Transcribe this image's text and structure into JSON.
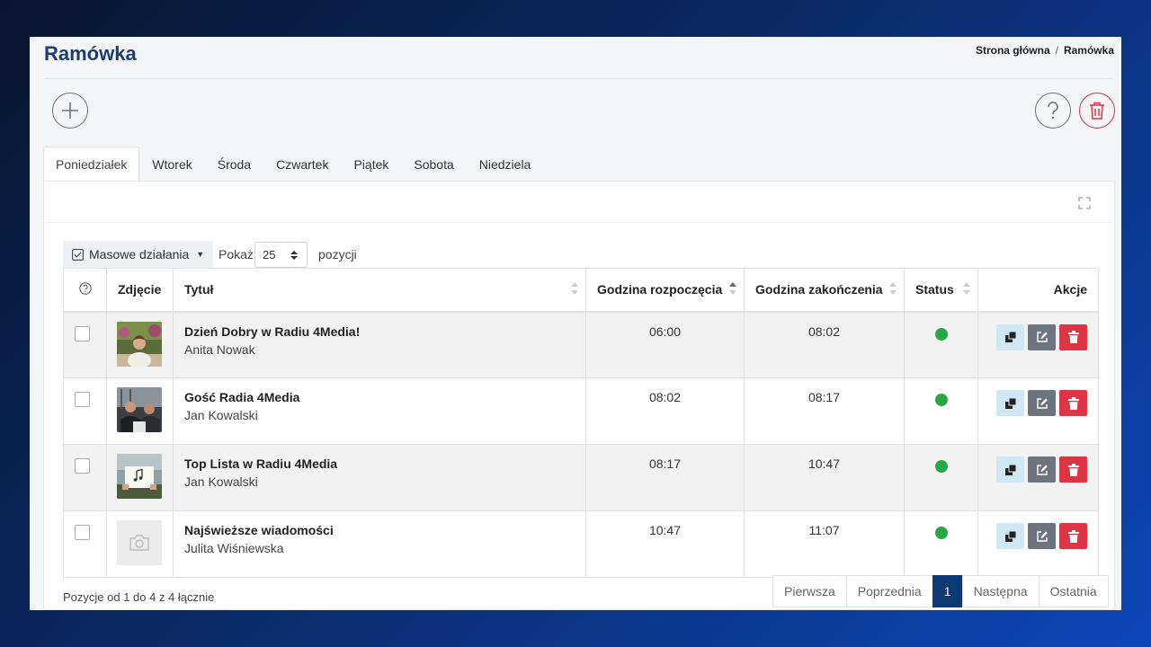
{
  "page": {
    "title": "Ramówka"
  },
  "breadcrumb": {
    "home": "Strona główna",
    "sep": "/",
    "current": "Ramówka"
  },
  "tabs": [
    "Poniedziałek",
    "Wtorek",
    "Środa",
    "Czwartek",
    "Piątek",
    "Sobota",
    "Niedziela"
  ],
  "active_tab": "Poniedziałek",
  "toolbar": {
    "bulk_label": "Masowe działania",
    "show_label": "Pokaż",
    "page_size": "25",
    "items_label": "pozycji"
  },
  "table": {
    "headers": {
      "photo": "Zdjęcie",
      "title": "Tytuł",
      "start": "Godzina rozpoczęcia",
      "end": "Godzina zakończenia",
      "status": "Status",
      "actions": "Akcje"
    },
    "rows": [
      {
        "title": "Dzień Dobry w Radiu 4Media!",
        "author": "Anita Nowak",
        "start": "06:00",
        "end": "08:02",
        "status": "active",
        "photo": "woman-portrait"
      },
      {
        "title": "Gość Radia 4Media",
        "author": "Jan Kowalski",
        "start": "08:02",
        "end": "08:17",
        "status": "active",
        "photo": "two-men-talking"
      },
      {
        "title": "Top Lista w Radiu 4Media",
        "author": "Jan Kowalski",
        "start": "08:17",
        "end": "10:47",
        "status": "active",
        "photo": "music-sign"
      },
      {
        "title": "Najświeższe wiadomości",
        "author": "Julita Wiśniewska",
        "start": "10:47",
        "end": "11:07",
        "status": "active",
        "photo": "camera-placeholder"
      }
    ]
  },
  "footer": {
    "info": "Pozycje od 1 do 4 z 4 łącznie"
  },
  "pagination": {
    "first": "Pierwsza",
    "prev": "Poprzednia",
    "current": "1",
    "next": "Następna",
    "last": "Ostatnia"
  },
  "colors": {
    "title": "#1c3d6e",
    "status_active": "#28a745",
    "delete": "#dc3545",
    "edit": "#6c757d",
    "copy": "#cfe8f3",
    "page_active": "#0b3a75"
  }
}
